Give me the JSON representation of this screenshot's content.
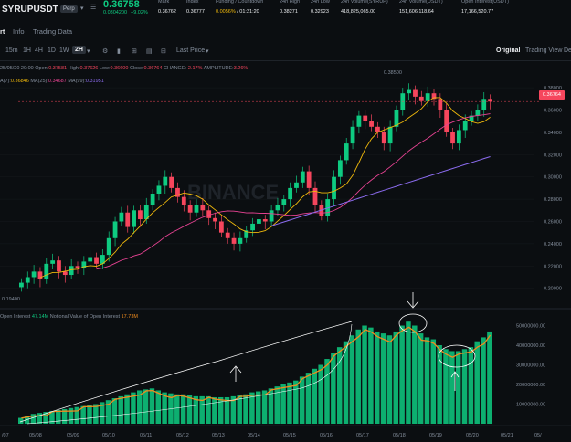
{
  "ticker": {
    "symbol": "SYRUPUSDT",
    "badge": "Perp",
    "last_price": "0.36758",
    "last_price_sub": "0.0304200",
    "change_pct": "+9.02%",
    "stats": [
      {
        "label": "Mark",
        "value": "0.36762"
      },
      {
        "label": "Index",
        "value": "0.36777"
      },
      {
        "label": "Funding / Countdown",
        "value": "0.0056%",
        "value2": "01:21:20"
      },
      {
        "label": "24h High",
        "value": "0.38271"
      },
      {
        "label": "24h Low",
        "value": "0.32923"
      },
      {
        "label": "24h Volume(SYRUP)",
        "value": "418,825,065.00"
      },
      {
        "label": "24h Volume(USDT)",
        "value": "151,606,118.64"
      },
      {
        "label": "Open Interest(USDT)",
        "value": "17,166,520.77"
      }
    ]
  },
  "tabs": {
    "chart": "rt",
    "info": "Info",
    "trading_data": "Trading Data"
  },
  "toolbar": {
    "intervals": [
      "15m",
      "1H",
      "4H",
      "1D",
      "1W",
      "2H"
    ],
    "active_interval": "2H",
    "price_type": "Last Price",
    "view_original": "Original",
    "view_tradingview": "Trading View",
    "view_depth": "De"
  },
  "ohlc": {
    "date": "25/05/20 20:00",
    "open_label": "Open:",
    "open": "0.37581",
    "high_label": "High:",
    "high": "0.37626",
    "low_label": "Low:",
    "low": "0.36600",
    "close_label": "Close:",
    "close": "0.36764",
    "change_label": "CHANGE:",
    "change": "-2.17%",
    "amp_label": "AMPLITUDE:",
    "amp": "3.26%"
  },
  "ma": {
    "ma7_label": "A(7):",
    "ma7": "0.36846",
    "ma25_label": "MA(25):",
    "ma25": "0.34687",
    "ma99_label": "MA(99):",
    "ma99": "0.31951"
  },
  "colors": {
    "up": "#0ecb81",
    "down": "#f6465d",
    "ma7": "#f0b90b",
    "ma25": "#e84393",
    "ma99": "#8c6cf0",
    "oi_line": "#f08c1e"
  },
  "watermark": "BINANCE",
  "current_price_tag": "0.36764",
  "chart_data": {
    "type": "candlestick",
    "y_axis_labels": [
      "0.38000",
      "0.36000",
      "0.34000",
      "0.32000",
      "0.30000",
      "0.28000",
      "0.26000",
      "0.24000",
      "0.22000",
      "0.20000"
    ],
    "x_axis_labels": [
      "/07",
      "05/08",
      "05/09",
      "05/10",
      "05/11",
      "05/12",
      "05/13",
      "05/14",
      "05/15",
      "05/16",
      "05/17",
      "05/18",
      "05/19",
      "05/20",
      "05/21",
      "05/"
    ],
    "high_marker": "0.38500",
    "low_marker": "0.19400",
    "closes": [
      0.205,
      0.21,
      0.215,
      0.208,
      0.222,
      0.225,
      0.215,
      0.212,
      0.22,
      0.218,
      0.224,
      0.228,
      0.222,
      0.23,
      0.245,
      0.26,
      0.268,
      0.255,
      0.27,
      0.262,
      0.275,
      0.285,
      0.292,
      0.3,
      0.29,
      0.282,
      0.275,
      0.268,
      0.275,
      0.27,
      0.263,
      0.26,
      0.25,
      0.245,
      0.24,
      0.245,
      0.252,
      0.258,
      0.262,
      0.26,
      0.27,
      0.275,
      0.28,
      0.29,
      0.295,
      0.305,
      0.29,
      0.275,
      0.265,
      0.28,
      0.3,
      0.315,
      0.33,
      0.345,
      0.355,
      0.35,
      0.345,
      0.34,
      0.33,
      0.345,
      0.36,
      0.375,
      0.378,
      0.372,
      0.368,
      0.375,
      0.37,
      0.36,
      0.34,
      0.33,
      0.342,
      0.35,
      0.355,
      0.36,
      0.37,
      0.3676
    ],
    "open_interest_label": "Open Interest",
    "open_interest": "47.14M",
    "notional_label": "Notional Value of Open Interest",
    "notional": "17.73M",
    "oi_axis_labels": [
      "50000000.00",
      "40000000.00",
      "30000000.00",
      "20000000.00",
      "10000000.00"
    ],
    "oi_values": [
      3,
      4,
      5,
      5.5,
      6,
      6.5,
      7,
      7.5,
      8,
      8.5,
      9,
      9.5,
      10,
      11,
      12,
      13,
      14,
      15,
      16,
      17,
      17.5,
      18,
      17,
      16,
      15.5,
      15,
      15,
      14.5,
      14,
      14,
      14,
      13.5,
      13.5,
      13.5,
      14,
      14.5,
      15,
      16,
      16.5,
      17,
      18,
      19,
      20,
      21,
      22,
      24,
      26,
      28,
      30,
      33,
      36,
      39,
      42,
      45,
      48,
      50,
      49,
      47,
      46,
      45,
      47,
      50,
      52,
      50,
      46,
      44,
      43,
      40,
      38,
      37,
      37,
      38,
      39,
      42,
      44,
      47
    ]
  }
}
